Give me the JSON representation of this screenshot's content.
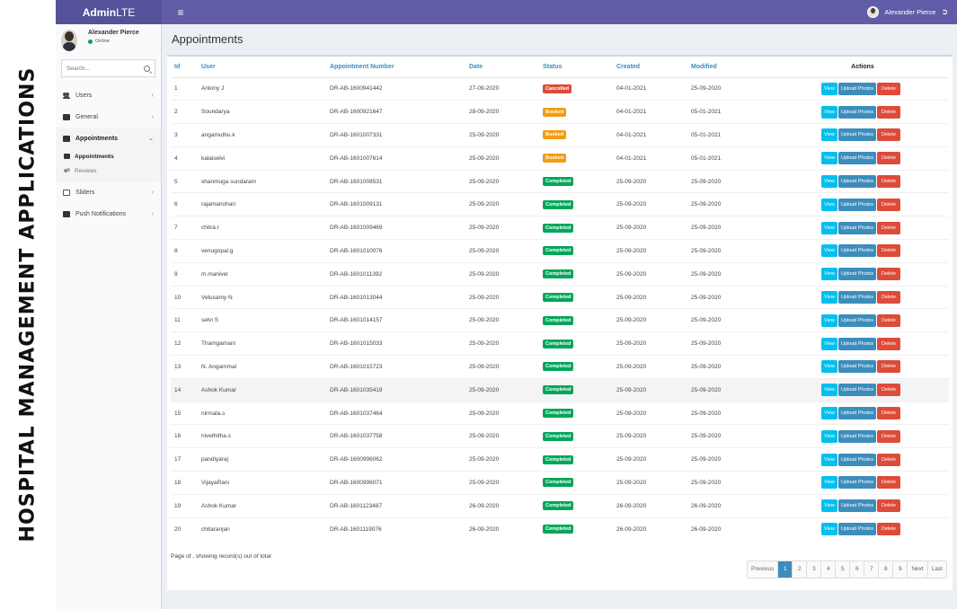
{
  "caption": "HOSPITAL MANAGEMENT APPLICATIONS",
  "brand": {
    "bold": "Admin",
    "rest": "LTE"
  },
  "topbar": {
    "toggle_icon": "bars-icon",
    "user_name": "Alexander Pierce",
    "signout_icon": "sign-out-icon"
  },
  "sidebar": {
    "user": {
      "name": "Alexander Pierce",
      "status": "Online"
    },
    "search": {
      "placeholder": "Search..."
    },
    "items": [
      {
        "label": "Users",
        "icon": "users-icon"
      },
      {
        "label": "General",
        "icon": "square-icon"
      },
      {
        "label": "Appointments",
        "icon": "square-icon"
      },
      {
        "label": "Sliders",
        "icon": "image-icon"
      },
      {
        "label": "Push Notifications",
        "icon": "square-icon"
      }
    ],
    "submenu": [
      {
        "label": "Appointments",
        "icon": "square-icon"
      },
      {
        "label": "Reviews",
        "icon": "comments-icon"
      }
    ]
  },
  "page_title": "Appointments",
  "table": {
    "headers": [
      "Id",
      "User",
      "Appointment Number",
      "Date",
      "Status",
      "Created",
      "Modified",
      "Actions"
    ],
    "action_labels": {
      "view": "View",
      "upload": "Upload Photos",
      "delete": "Delete"
    },
    "rows": [
      {
        "id": "1",
        "user": "Antony J",
        "number": "DR-AB-1600941442",
        "date": "27-09-2020",
        "status": "Cancelled",
        "created": "04-01-2021",
        "modified": "25-09-2020"
      },
      {
        "id": "2",
        "user": "Soundarya",
        "number": "DR-AB-1600921647",
        "date": "28-09-2020",
        "status": "Booked",
        "created": "04-01-2021",
        "modified": "05-01-2021"
      },
      {
        "id": "3",
        "user": "angamuthu.k",
        "number": "DR-AB-1601007331",
        "date": "25-09-2020",
        "status": "Booked",
        "created": "04-01-2021",
        "modified": "05-01-2021"
      },
      {
        "id": "4",
        "user": "kalaiselvi",
        "number": "DR-AB-1601007614",
        "date": "25-09-2020",
        "status": "Booked",
        "created": "04-01-2021",
        "modified": "05-01-2021"
      },
      {
        "id": "5",
        "user": "shanmuga sundaram",
        "number": "DR-AB-1601008531",
        "date": "25-09-2020",
        "status": "Completed",
        "created": "25-09-2020",
        "modified": "25-09-2020"
      },
      {
        "id": "6",
        "user": "rajamanohari",
        "number": "DR-AB-1601009131",
        "date": "25-09-2020",
        "status": "Completed",
        "created": "25-09-2020",
        "modified": "25-09-2020"
      },
      {
        "id": "7",
        "user": "chitra.r",
        "number": "DR-AB-1601009469",
        "date": "25-09-2020",
        "status": "Completed",
        "created": "25-09-2020",
        "modified": "25-09-2020"
      },
      {
        "id": "8",
        "user": "venugopal.g",
        "number": "DR-AB-1601010076",
        "date": "25-09-2020",
        "status": "Completed",
        "created": "25-09-2020",
        "modified": "25-09-2020"
      },
      {
        "id": "9",
        "user": "m.manivel",
        "number": "DR-AB-1601011392",
        "date": "25-09-2020",
        "status": "Completed",
        "created": "25-09-2020",
        "modified": "25-09-2020"
      },
      {
        "id": "10",
        "user": "Velusamy N",
        "number": "DR-AB-1601013044",
        "date": "25-09-2020",
        "status": "Completed",
        "created": "25-09-2020",
        "modified": "25-09-2020"
      },
      {
        "id": "11",
        "user": "selvi S",
        "number": "DR-AB-1601014157",
        "date": "25-09-2020",
        "status": "Completed",
        "created": "25-09-2020",
        "modified": "25-09-2020"
      },
      {
        "id": "12",
        "user": "Thamgamani",
        "number": "DR-AB-1601015033",
        "date": "25-09-2020",
        "status": "Completed",
        "created": "25-09-2020",
        "modified": "25-09-2020"
      },
      {
        "id": "13",
        "user": "N. Angammal",
        "number": "DR-AB-1601015723",
        "date": "25-09-2020",
        "status": "Completed",
        "created": "25-09-2020",
        "modified": "25-09-2020"
      },
      {
        "id": "14",
        "user": "Ashok Kumar",
        "number": "DR-AB-1601035419",
        "date": "25-09-2020",
        "status": "Completed",
        "created": "25-09-2020",
        "modified": "25-09-2020"
      },
      {
        "id": "15",
        "user": "nirmala.s",
        "number": "DR-AB-1601037464",
        "date": "25-09-2020",
        "status": "Completed",
        "created": "25-09-2020",
        "modified": "25-09-2020"
      },
      {
        "id": "16",
        "user": "nivethitha.s",
        "number": "DR-AB-1601037758",
        "date": "25-09-2020",
        "status": "Completed",
        "created": "25-09-2020",
        "modified": "25-09-2020"
      },
      {
        "id": "17",
        "user": "pandiyaraj",
        "number": "DR-AB-1600996062",
        "date": "25-09-2020",
        "status": "Completed",
        "created": "25-09-2020",
        "modified": "25-09-2020"
      },
      {
        "id": "18",
        "user": "VijayaRani",
        "number": "DR-AB-1600996071",
        "date": "25-09-2020",
        "status": "Completed",
        "created": "25-09-2020",
        "modified": "25-09-2020"
      },
      {
        "id": "19",
        "user": "Ashok Kumar",
        "number": "DR-AB-1601123487",
        "date": "26-09-2020",
        "status": "Completed",
        "created": "26-09-2020",
        "modified": "26-09-2020"
      },
      {
        "id": "20",
        "user": "chitaranjan",
        "number": "DR-AB-1601119076",
        "date": "26-09-2020",
        "status": "Completed",
        "created": "26-09-2020",
        "modified": "26-09-2020"
      }
    ]
  },
  "footer": {
    "info": "Page of , showing record(s) out of total"
  },
  "pagination": [
    "Previous",
    "1",
    "2",
    "3",
    "4",
    "5",
    "6",
    "7",
    "8",
    "9",
    "Next",
    "Last"
  ],
  "colors": {
    "topbar": "#605ca8",
    "cancelled": "#dd4b39",
    "booked": "#f39c12",
    "completed": "#00a65a",
    "view": "#00c0ef",
    "upload": "#3c8dbc",
    "delete": "#dd4b39"
  }
}
